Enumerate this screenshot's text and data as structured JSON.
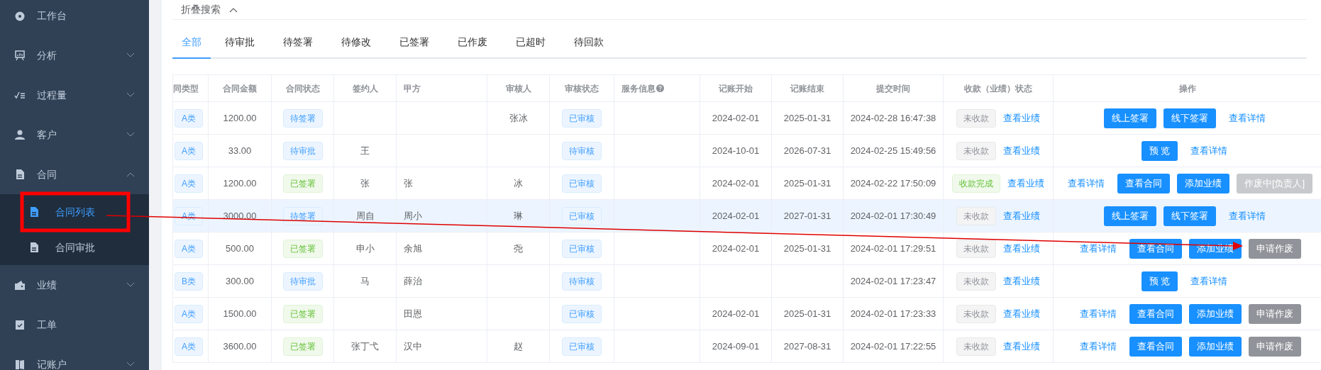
{
  "sidebar": {
    "items": [
      {
        "label": "工作台"
      },
      {
        "label": "分析",
        "expanded": false
      },
      {
        "label": "过程量",
        "expanded": false
      },
      {
        "label": "客户",
        "expanded": false
      },
      {
        "label": "合同",
        "expanded": true,
        "children": [
          {
            "label": "合同列表",
            "selected": true
          },
          {
            "label": "合同审批",
            "selected": false
          }
        ]
      },
      {
        "label": "业绩",
        "expanded": false
      },
      {
        "label": "工单"
      },
      {
        "label": "记账户",
        "expanded": false
      }
    ]
  },
  "search_toggle": {
    "label": "折叠搜索",
    "expanded": true
  },
  "tabs": [
    {
      "label": "全部",
      "selected": true
    },
    {
      "label": "待审批",
      "selected": false
    },
    {
      "label": "待签署",
      "selected": false
    },
    {
      "label": "待修改",
      "selected": false
    },
    {
      "label": "已签署",
      "selected": false
    },
    {
      "label": "已作废",
      "selected": false
    },
    {
      "label": "已超时",
      "selected": false
    },
    {
      "label": "待回款",
      "selected": false
    }
  ],
  "table": {
    "columns": [
      "同类型",
      "合同金额",
      "合同状态",
      "签约人",
      "甲方",
      "审核人",
      "审核状态",
      "服务信息",
      "记账开始",
      "记账结束",
      "提交时间",
      "收款（业绩）状态",
      "操作"
    ],
    "rows": [
      {
        "highlighted": false,
        "type": "A类",
        "amount": "1200.00",
        "status": {
          "text": "待签署",
          "kind": "info"
        },
        "reviewer": "张冰",
        "review": "已审核",
        "start": "2024-02-01",
        "end": "2025-01-31",
        "submitted": "2024-02-28 16:47:38",
        "receipt": {
          "text": "未收款",
          "kind": "gray"
        },
        "receipt_link": "查看业绩",
        "actions": [
          {
            "label": "线上签署",
            "kind": "primary"
          },
          {
            "label": "线下签署",
            "kind": "primary"
          },
          {
            "label": "查看详情",
            "kind": "link"
          }
        ]
      },
      {
        "highlighted": false,
        "type": "A类",
        "amount": "33.00",
        "status": {
          "text": "待审批",
          "kind": "info"
        },
        "signer": "王",
        "review": "待审核",
        "start": "2024-10-01",
        "end": "2026-07-31",
        "submitted": "2024-02-25 15:49:56",
        "receipt": {
          "text": "未收款",
          "kind": "gray"
        },
        "receipt_link": "查看业绩",
        "actions": [
          {
            "label": "预 览",
            "kind": "primary"
          },
          {
            "label": "查看详情",
            "kind": "link"
          }
        ]
      },
      {
        "highlighted": false,
        "type": "A类",
        "amount": "1200.00",
        "status": {
          "text": "已签署",
          "kind": "success"
        },
        "signer": "张",
        "party_a": "张",
        "reviewer": "冰",
        "review": "已审核",
        "start": "2024-02-01",
        "end": "2025-01-31",
        "submitted": "2024-02-22 17:50:09",
        "receipt": {
          "text": "收款完成",
          "kind": "success"
        },
        "receipt_link": "查看业绩",
        "actions": [
          {
            "label": "查看详情",
            "kind": "link"
          },
          {
            "label": "查看合同",
            "kind": "primary"
          },
          {
            "label": "添加业绩",
            "kind": "primary"
          },
          {
            "label": "作废中[负责人]",
            "kind": "disabled"
          }
        ]
      },
      {
        "highlighted": true,
        "type": "A类",
        "amount": "3000.00",
        "status": {
          "text": "待签署",
          "kind": "info"
        },
        "signer": "周自",
        "party_a": "周小",
        "reviewer": "琳",
        "review": "已审核",
        "start": "2024-02-01",
        "end": "2027-01-31",
        "submitted": "2024-02-01 17:30:49",
        "receipt": {
          "text": "未收款",
          "kind": "gray"
        },
        "receipt_link": "查看业绩",
        "actions": [
          {
            "label": "线上签署",
            "kind": "primary"
          },
          {
            "label": "线下签署",
            "kind": "primary"
          },
          {
            "label": "查看详情",
            "kind": "link"
          }
        ]
      },
      {
        "highlighted": false,
        "type": "A类",
        "amount": "500.00",
        "status": {
          "text": "已签署",
          "kind": "success"
        },
        "signer": "申小",
        "party_a": "余旭",
        "reviewer": "尧",
        "review": "已审核",
        "start": "2024-02-01",
        "end": "2025-01-31",
        "submitted": "2024-02-01 17:29:51",
        "receipt": {
          "text": "未收款",
          "kind": "gray"
        },
        "receipt_link": "查看业绩",
        "actions": [
          {
            "label": "查看详情",
            "kind": "link"
          },
          {
            "label": "查看合同",
            "kind": "primary"
          },
          {
            "label": "添加业绩",
            "kind": "primary"
          },
          {
            "label": "申请作废",
            "kind": "gray"
          }
        ]
      },
      {
        "highlighted": false,
        "type": "B类",
        "amount": "300.00",
        "status": {
          "text": "待审批",
          "kind": "info"
        },
        "signer": "马",
        "party_a": "薛治",
        "review": "待审核",
        "submitted": "2024-02-01 17:23:47",
        "receipt": {
          "text": "未收款",
          "kind": "gray"
        },
        "receipt_link": "查看业绩",
        "actions": [
          {
            "label": "预 览",
            "kind": "primary"
          },
          {
            "label": "查看详情",
            "kind": "link"
          }
        ]
      },
      {
        "highlighted": false,
        "type": "A类",
        "amount": "1500.00",
        "status": {
          "text": "已签署",
          "kind": "success"
        },
        "party_a": "田恩",
        "review": "已审核",
        "start": "2024-02-01",
        "end": "2025-01-31",
        "submitted": "2024-02-01 17:23:33",
        "receipt": {
          "text": "未收款",
          "kind": "gray"
        },
        "receipt_link": "查看业绩",
        "actions": [
          {
            "label": "查看详情",
            "kind": "link"
          },
          {
            "label": "查看合同",
            "kind": "primary"
          },
          {
            "label": "添加业绩",
            "kind": "primary"
          },
          {
            "label": "申请作废",
            "kind": "gray"
          }
        ]
      },
      {
        "highlighted": false,
        "type": "A类",
        "amount": "3600.00",
        "status": {
          "text": "已签署",
          "kind": "success"
        },
        "signer": "张丁弋",
        "party_a": "汉中",
        "reviewer": "赵",
        "review": "已审核",
        "start": "2024-09-01",
        "end": "2027-08-31",
        "submitted": "2024-02-01 17:22:55",
        "receipt": {
          "text": "未收款",
          "kind": "gray"
        },
        "receipt_link": "查看业绩",
        "actions": [
          {
            "label": "查看详情",
            "kind": "link"
          },
          {
            "label": "查看合同",
            "kind": "primary"
          },
          {
            "label": "添加业绩",
            "kind": "primary"
          },
          {
            "label": "申请作废",
            "kind": "gray"
          }
        ]
      }
    ]
  }
}
